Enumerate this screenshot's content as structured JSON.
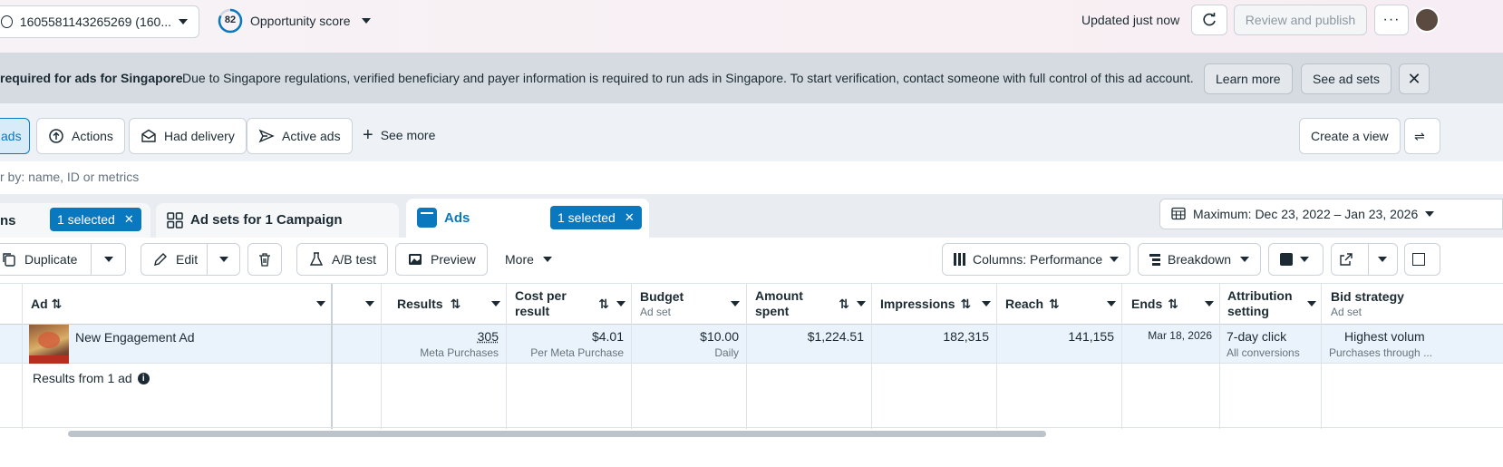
{
  "topbar": {
    "account": "1605581143265269 (160...",
    "score_value": "82",
    "score_label": "Opportunity score",
    "updated": "Updated just now",
    "review_publish": "Review and publish"
  },
  "banner": {
    "title": "required for ads for Singapore",
    "message": "Due to Singapore regulations, verified beneficiary and payer information is required to run ads in Singapore. To start verification, contact someone with full control of this ad account.",
    "learn_more": "Learn more",
    "see_ad_sets": "See ad sets"
  },
  "filters": {
    "active_partial": "ads",
    "items": [
      "Actions",
      "Had delivery",
      "Active ads"
    ],
    "see_more": "See more",
    "create_view": "Create a view"
  },
  "search": {
    "placeholder": "r by: name, ID or metrics"
  },
  "tabs": {
    "campaigns_partial": "ns",
    "campaigns_chip": "1 selected",
    "adsets": "Ad sets for 1 Campaign",
    "ads": "Ads",
    "ads_chip": "1 selected",
    "date_range": "Maximum: Dec 23, 2022 – Jan 23, 2026"
  },
  "toolbar": {
    "duplicate": "Duplicate",
    "edit": "Edit",
    "ab_test": "A/B test",
    "preview": "Preview",
    "more": "More",
    "columns": "Columns: Performance",
    "breakdown": "Breakdown"
  },
  "table": {
    "headers": {
      "ad": "Ad",
      "results": "Results",
      "cost_line1": "Cost per",
      "cost_line2": "result",
      "budget": "Budget",
      "budget_sub": "Ad set",
      "amount_line1": "Amount",
      "amount_line2": "spent",
      "impressions": "Impressions",
      "reach": "Reach",
      "ends": "Ends",
      "attr_line1": "Attribution",
      "attr_line2": "setting",
      "bid": "Bid strategy",
      "bid_sub": "Ad set"
    },
    "row": {
      "name": "New Engagement Ad",
      "results": "305",
      "results_sub": "Meta Purchases",
      "cost": "$4.01",
      "cost_sub": "Per Meta Purchase",
      "budget": "$10.00",
      "budget_sub": "Daily",
      "amount": "$1,224.51",
      "impressions": "182,315",
      "reach": "141,155",
      "ends": "Mar 18, 2026",
      "attr": "7-day click",
      "attr_sub": "All conversions",
      "bid": "Highest volum",
      "bid_sub": "Purchases through ..."
    },
    "footer": "Results from 1 ad"
  },
  "colors": {
    "accent": "#0a78be",
    "chip_bg": "#0a78be",
    "banner_bg": "#d5dbe1"
  }
}
